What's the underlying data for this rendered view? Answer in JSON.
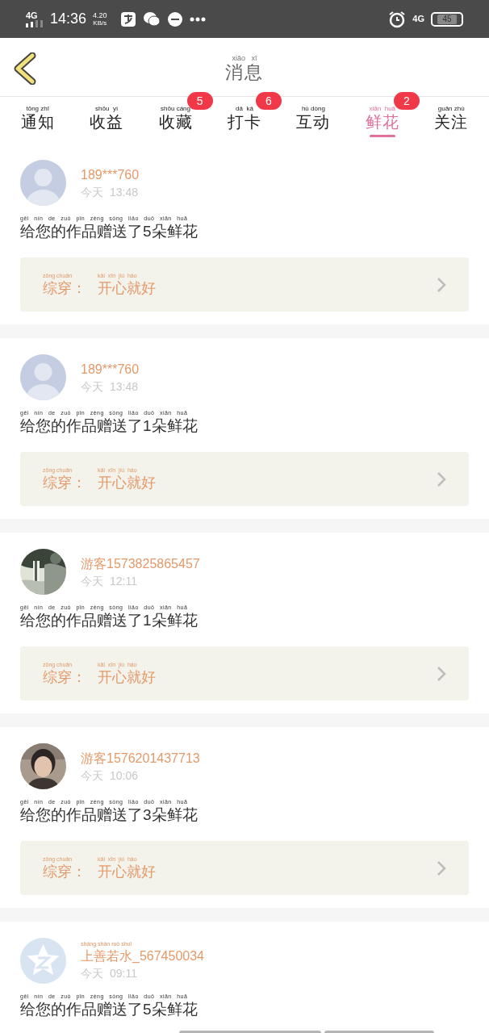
{
  "status_bar": {
    "network": "4G",
    "time": "14:36",
    "speed": "4.20",
    "speed_unit": "KB/s",
    "network_right": "4G",
    "battery": "45"
  },
  "header": {
    "title_pinyin": "xiāo   xī",
    "title": "消息"
  },
  "tabs": [
    {
      "pinyin": "tōng zhī",
      "label": "通知",
      "selected": false
    },
    {
      "pinyin": "shōu  yì",
      "label": "收益",
      "selected": false
    },
    {
      "pinyin": "shōu cáng",
      "label": "收藏",
      "badge": "5",
      "selected": false
    },
    {
      "pinyin": "dǎ  kǎ",
      "label": "打卡",
      "badge": "6",
      "selected": false
    },
    {
      "pinyin": "hù dòng",
      "label": "互动",
      "selected": false
    },
    {
      "pinyin": "xiān  huā",
      "label": "鲜花",
      "badge": "2",
      "selected": true
    },
    {
      "pinyin": "guān zhù",
      "label": "关注",
      "selected": false
    }
  ],
  "messages": [
    {
      "avatar": {
        "kind": "default"
      },
      "name": "189***760",
      "day": "今天",
      "time": "13:48",
      "message_pinyin": "gěi nín de zuò pǐn zèng sòng liǎo duǒ xiān huā",
      "message": "给您的作品赠送了5朵鲜花",
      "work_category_pinyin": "zōng chuān",
      "work_category": "综穿：",
      "work_title_pinyin": "kāi  xīn  jiù  hǎo",
      "work_title": "开心就好"
    },
    {
      "avatar": {
        "kind": "default"
      },
      "name": "189***760",
      "day": "今天",
      "time": "13:48",
      "message_pinyin": "gěi nín de zuò pǐn zèng sòng liǎo duǒ xiān huā",
      "message": "给您的作品赠送了1朵鲜花",
      "work_category_pinyin": "zōng chuān",
      "work_category": "综穿：",
      "work_title_pinyin": "kāi  xīn  jiù  hǎo",
      "work_title": "开心就好"
    },
    {
      "name": "游客1573825865457",
      "day": "今天",
      "time": "12:11",
      "message_pinyin": "gěi nín de zuò pǐn zèng sòng liǎo duǒ xiān huā",
      "message": "给您的作品赠送了1朵鲜花",
      "work_category_pinyin": "zōng chuān",
      "work_category": "综穿：",
      "work_title_pinyin": "kāi  xīn  jiù  hǎo",
      "work_title": "开心就好"
    },
    {
      "avatar": {
        "kind": "person"
      },
      "name": "游客1576201437713",
      "day": "今天",
      "time": "10:06",
      "message_pinyin": "gěi nín de zuò pǐn zèng sòng liǎo duǒ xiān huā",
      "message": "给您的作品赠送了3朵鲜花",
      "work_category_pinyin": "zōng chuān",
      "work_category": "综穿：",
      "work_title_pinyin": "kāi  xīn  jiù  hǎo",
      "work_title": "开心就好"
    },
    {
      "avatar": {
        "kind": "star"
      },
      "name_pinyin": "shàng shàn ruò shuǐ",
      "name": "上善若水_567450034",
      "day": "今天",
      "time": "09:11",
      "message_pinyin": "gěi nín de zuò pǐn zèng sòng liǎo duǒ xiān huā",
      "message": "给您的作品赠送了5朵鲜花"
    }
  ]
}
